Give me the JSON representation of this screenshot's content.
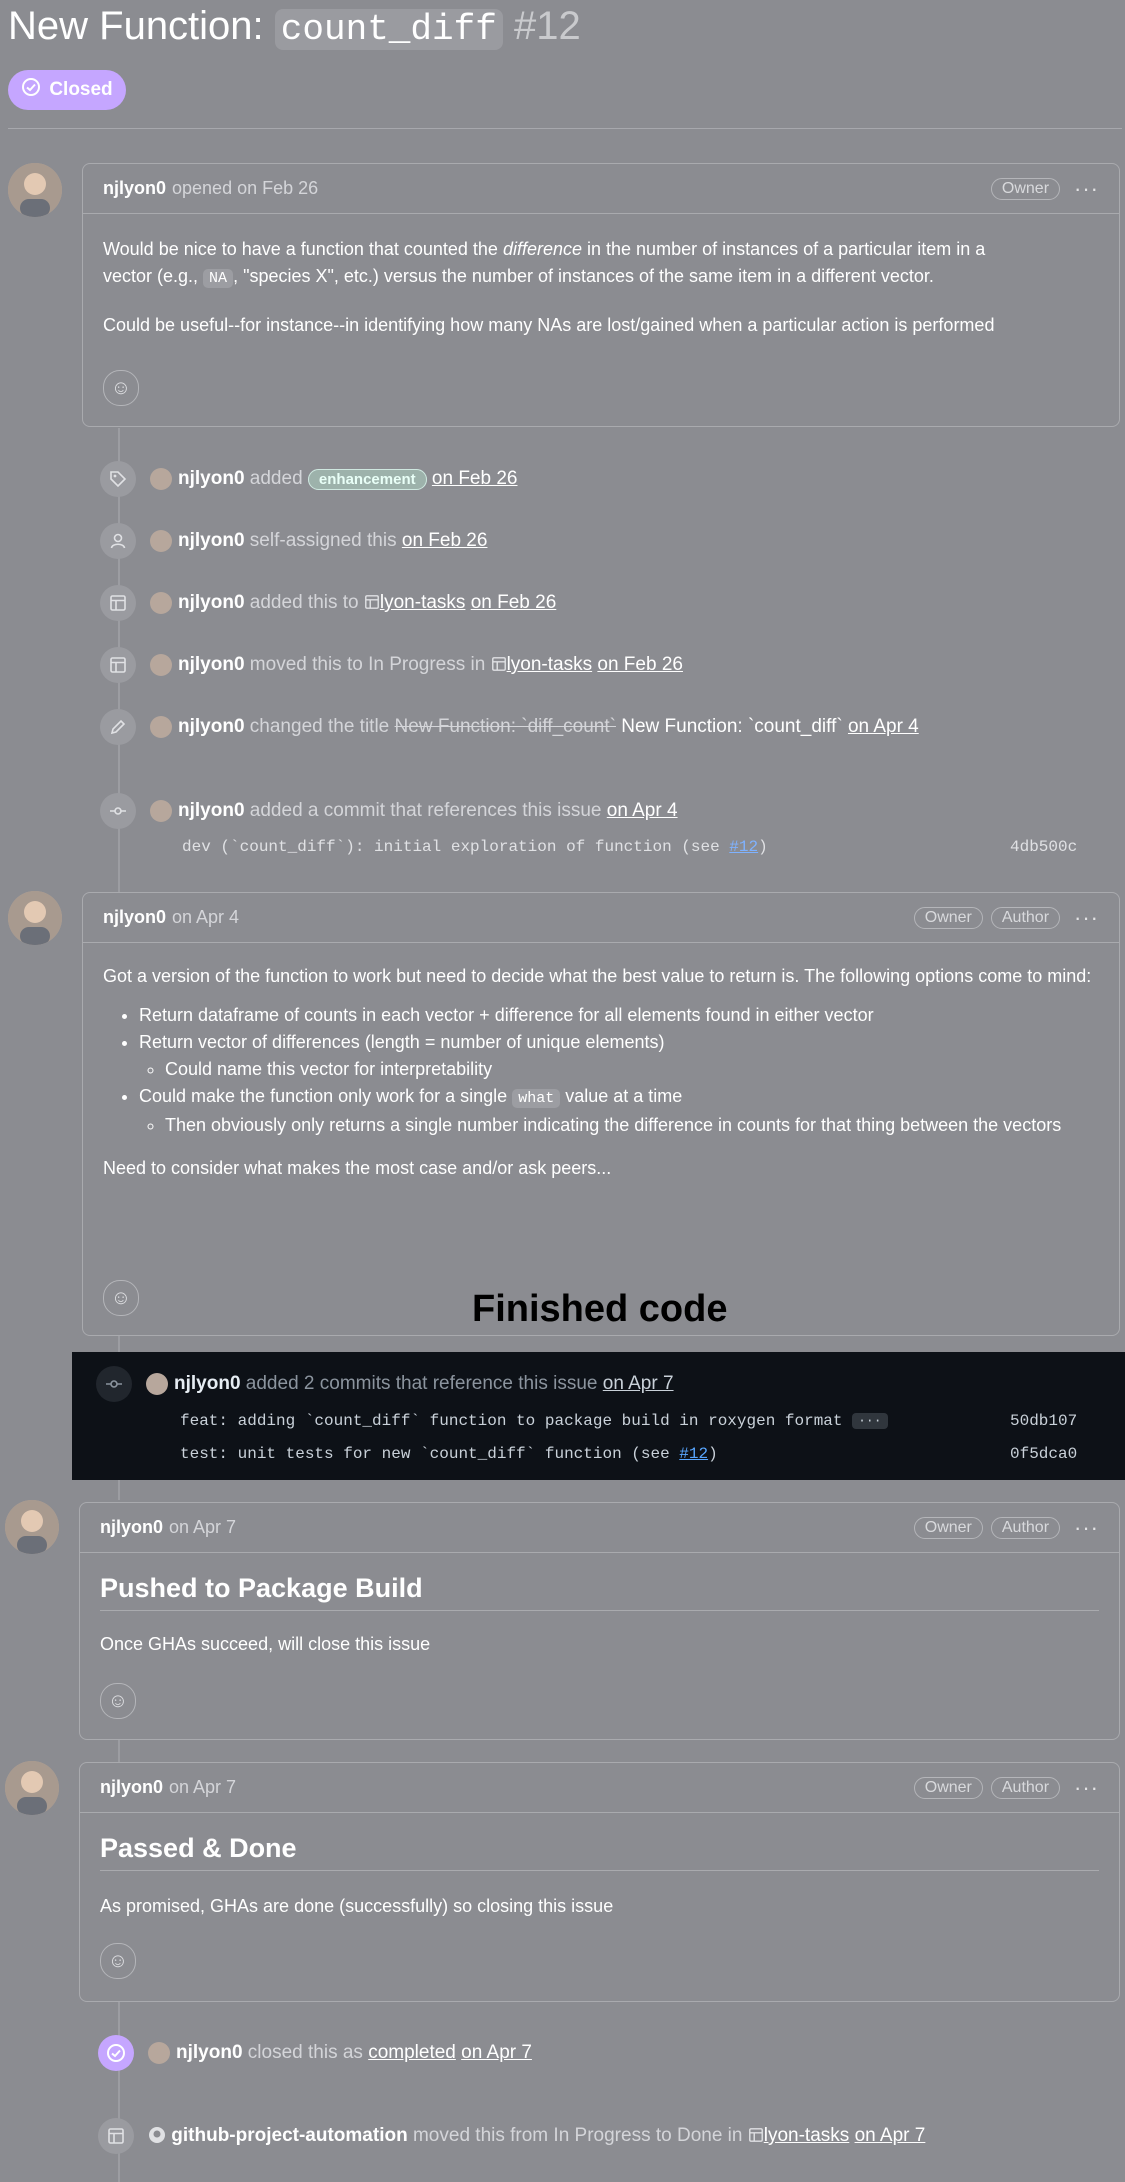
{
  "header": {
    "title_prefix": "New Function: ",
    "title_code": "count_diff",
    "number": "#12",
    "status": "Closed"
  },
  "opening_comment": {
    "author": "njlyon0",
    "action": "opened on Feb 26",
    "badge": "Owner",
    "p1_a": "Would be nice to have a function that counted the ",
    "p1_em": "difference",
    "p1_b": " in the number of instances of a particular item in a",
    "p1_c": "vector (e.g., ",
    "p1_code": "NA",
    "p1_d": ", \"species X\", etc.) versus the number of instances of the same item in a different vector.",
    "p2": "Could be useful--for instance--in identifying how many NAs are lost/gained when a particular action is performed"
  },
  "events": {
    "label_event": {
      "user": "njlyon0",
      "text": "added",
      "label": "enhancement",
      "time": "on Feb 26"
    },
    "assign_event": {
      "user": "njlyon0",
      "text": "self-assigned this",
      "time": "on Feb 26"
    },
    "project_add": {
      "user": "njlyon0",
      "text": "added this to",
      "project": "lyon-tasks",
      "time": "on Feb 26"
    },
    "project_move": {
      "user": "njlyon0",
      "text": "moved this to In Progress in",
      "project": "lyon-tasks",
      "time": "on Feb 26"
    },
    "rename": {
      "user": "njlyon0",
      "text": "changed the title",
      "old": "New Function: `diff_count`",
      "new": "New Function: `count_diff`",
      "time": "on Apr 4"
    },
    "commit1": {
      "user": "njlyon0",
      "text": "added a commit that references this issue",
      "time": "on Apr 4",
      "msg": "dev (`count_diff`): initial exploration of function (see ",
      "ref": "#12",
      "msg_end": ")",
      "sha": "4db500c"
    }
  },
  "comment2": {
    "author": "njlyon0",
    "when": "on Apr 4",
    "badge1": "Owner",
    "badge2": "Author",
    "intro": "Got a version of the function to work but need to decide what the best value to return is. The following options come to mind:",
    "b1": "Return dataframe of counts in each vector + difference for all elements found in either vector",
    "b2": "Return vector of differences (length = number of unique elements)",
    "b2_sub": "Could name this vector for interpretability",
    "b3_a": "Could make the function only work for a single ",
    "b3_code": "what",
    "b3_b": " value at a time",
    "b3_sub": "Then obviously only returns a single number indicating the difference in counts for that thing between the vectors",
    "outro": "Need to consider what makes the most case and/or ask peers..."
  },
  "overlay": {
    "finished": "Finished code"
  },
  "commits2": {
    "user": "njlyon0",
    "text": "added 2 commits that reference this issue",
    "time": "on Apr 7",
    "c1": "feat: adding `count_diff` function to package build in roxygen format",
    "c1_more": "···",
    "c1_sha": "50db107",
    "c2": "test: unit tests for new `count_diff` function (see ",
    "c2_ref": "#12",
    "c2_end": ")",
    "c2_sha": "0f5dca0"
  },
  "comment3": {
    "author": "njlyon0",
    "when": "on Apr 7",
    "badge1": "Owner",
    "badge2": "Author",
    "heading": "Pushed to Package Build",
    "text": "Once GHAs succeed, will close this issue"
  },
  "comment4": {
    "author": "njlyon0",
    "when": "on Apr 7",
    "badge1": "Owner",
    "badge2": "Author",
    "heading": "Passed & Done",
    "text": "As promised, GHAs are done (successfully) so closing this issue"
  },
  "close_event": {
    "user": "njlyon0",
    "text": "closed this as",
    "state": "completed",
    "time": "on Apr 7"
  },
  "final_event": {
    "user": "github-project-automation",
    "text": "moved this from In Progress to Done in",
    "project": "lyon-tasks",
    "time": "on Apr 7"
  },
  "dots": "···",
  "smiley": "☺"
}
